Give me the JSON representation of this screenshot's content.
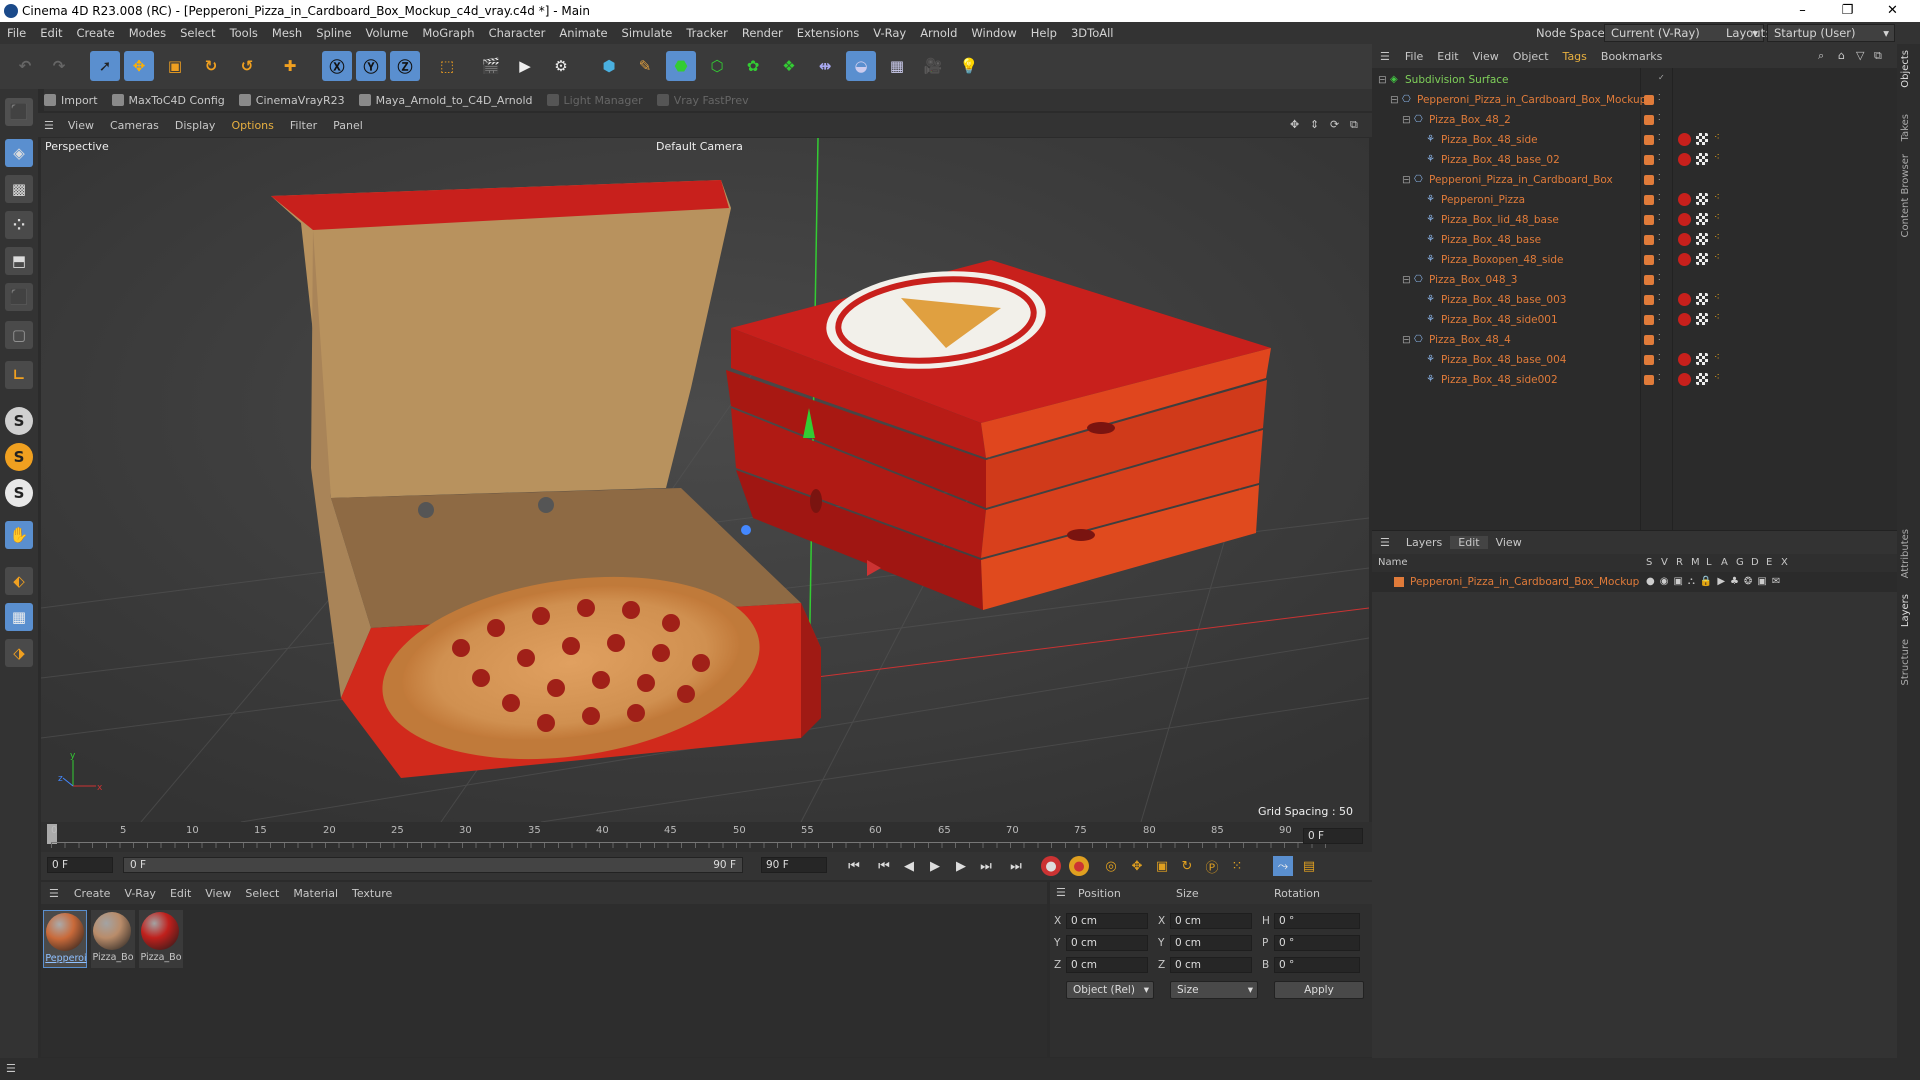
{
  "window": {
    "title": "Cinema 4D R23.008 (RC) - [Pepperoni_Pizza_in_Cardboard_Box_Mockup_c4d_vray.c4d *] - Main",
    "minimize": "–",
    "restore": "❐",
    "close": "✕"
  },
  "menu": [
    "File",
    "Edit",
    "Create",
    "Modes",
    "Select",
    "Tools",
    "Mesh",
    "Spline",
    "Volume",
    "MoGraph",
    "Character",
    "Animate",
    "Simulate",
    "Tracker",
    "Render",
    "Extensions",
    "V-Ray",
    "Arnold",
    "Window",
    "Help",
    "3DToAll"
  ],
  "nodespace": {
    "label": "Node Space:",
    "value": "Current (V-Ray)"
  },
  "layout": {
    "label": "Layout:",
    "value": "Startup (User)"
  },
  "plugins": [
    "Import",
    "MaxToC4D Config",
    "CinemaVrayR23",
    "Maya_Arnold_to_C4D_Arnold",
    "Light Manager",
    "Vray FastPrev"
  ],
  "viewport_menu": [
    "View",
    "Cameras",
    "Display",
    "Options",
    "Filter",
    "Panel"
  ],
  "viewport": {
    "name": "Perspective",
    "camera": "Default Camera",
    "grid_spacing": "Grid Spacing : 50 cm"
  },
  "timeline": {
    "ticks": [
      "0",
      "5",
      "10",
      "15",
      "20",
      "25",
      "30",
      "35",
      "40",
      "45",
      "50",
      "55",
      "60",
      "65",
      "70",
      "75",
      "80",
      "85",
      "90"
    ],
    "current": "0 F",
    "end_field": "0 F"
  },
  "transport": {
    "start": "0 F",
    "cur": "0 F",
    "end1": "90 F",
    "end2": "90 F"
  },
  "materials_menu": [
    "Create",
    "V-Ray",
    "Edit",
    "View",
    "Select",
    "Material",
    "Texture"
  ],
  "materials": [
    {
      "name": "Pepperoi",
      "color": "#c96a3a"
    },
    {
      "name": "Pizza_Bo",
      "color": "#b98c6a"
    },
    {
      "name": "Pizza_Bo",
      "color": "#c0201c"
    }
  ],
  "coords": {
    "headers": {
      "position": "Position",
      "size": "Size",
      "rotation": "Rotation"
    },
    "rows": [
      {
        "axis": "X",
        "pos": "0 cm",
        "saxis": "X",
        "size": "0 cm",
        "raxis": "H",
        "rot": "0 °"
      },
      {
        "axis": "Y",
        "pos": "0 cm",
        "saxis": "Y",
        "size": "0 cm",
        "raxis": "P",
        "rot": "0 °"
      },
      {
        "axis": "Z",
        "pos": "0 cm",
        "saxis": "Z",
        "size": "0 cm",
        "raxis": "B",
        "rot": "0 °"
      }
    ],
    "mode": "Object (Rel)",
    "sizemode": "Size",
    "apply": "Apply"
  },
  "object_manager": {
    "menu": [
      "File",
      "Edit",
      "View",
      "Object",
      "Tags",
      "Bookmarks"
    ],
    "tree": [
      {
        "name": "Subdivision Surface",
        "depth": 0,
        "tags": false
      },
      {
        "name": "Pepperoni_Pizza_in_Cardboard_Box_Mockup",
        "depth": 1,
        "tags": false
      },
      {
        "name": "Pizza_Box_48_2",
        "depth": 2,
        "tags": false
      },
      {
        "name": "Pizza_Box_48_side",
        "depth": 3,
        "tags": true
      },
      {
        "name": "Pizza_Box_48_base_02",
        "depth": 3,
        "tags": true
      },
      {
        "name": "Pepperoni_Pizza_in_Cardboard_Box",
        "depth": 2,
        "tags": false
      },
      {
        "name": "Pepperoni_Pizza",
        "depth": 3,
        "tags": true
      },
      {
        "name": "Pizza_Box_lid_48_base",
        "depth": 3,
        "tags": true
      },
      {
        "name": "Pizza_Box_48_base",
        "depth": 3,
        "tags": true
      },
      {
        "name": "Pizza_Boxopen_48_side",
        "depth": 3,
        "tags": true
      },
      {
        "name": "Pizza_Box_048_3",
        "depth": 2,
        "tags": false
      },
      {
        "name": "Pizza_Box_48_base_003",
        "depth": 3,
        "tags": true
      },
      {
        "name": "Pizza_Box_48_side001",
        "depth": 3,
        "tags": true
      },
      {
        "name": "Pizza_Box_48_4",
        "depth": 2,
        "tags": false
      },
      {
        "name": "Pizza_Box_48_base_004",
        "depth": 3,
        "tags": true
      },
      {
        "name": "Pizza_Box_48_side002",
        "depth": 3,
        "tags": true
      }
    ]
  },
  "layers": {
    "menu": [
      "Layers",
      "Edit",
      "View"
    ],
    "columns": [
      "Name",
      "S",
      "V",
      "R",
      "M",
      "L",
      "A",
      "G",
      "D",
      "E",
      "X"
    ],
    "row": "Pepperoni_Pizza_in_Cardboard_Box_Mockup"
  },
  "side_tabs": [
    "Objects",
    "Takes",
    "Content Browser",
    "Attributes",
    "Layers",
    "Structure"
  ],
  "colors": {
    "accent": "#e07b3a",
    "active_tool": "#5a8fcf",
    "box_red": "#c8201c"
  }
}
